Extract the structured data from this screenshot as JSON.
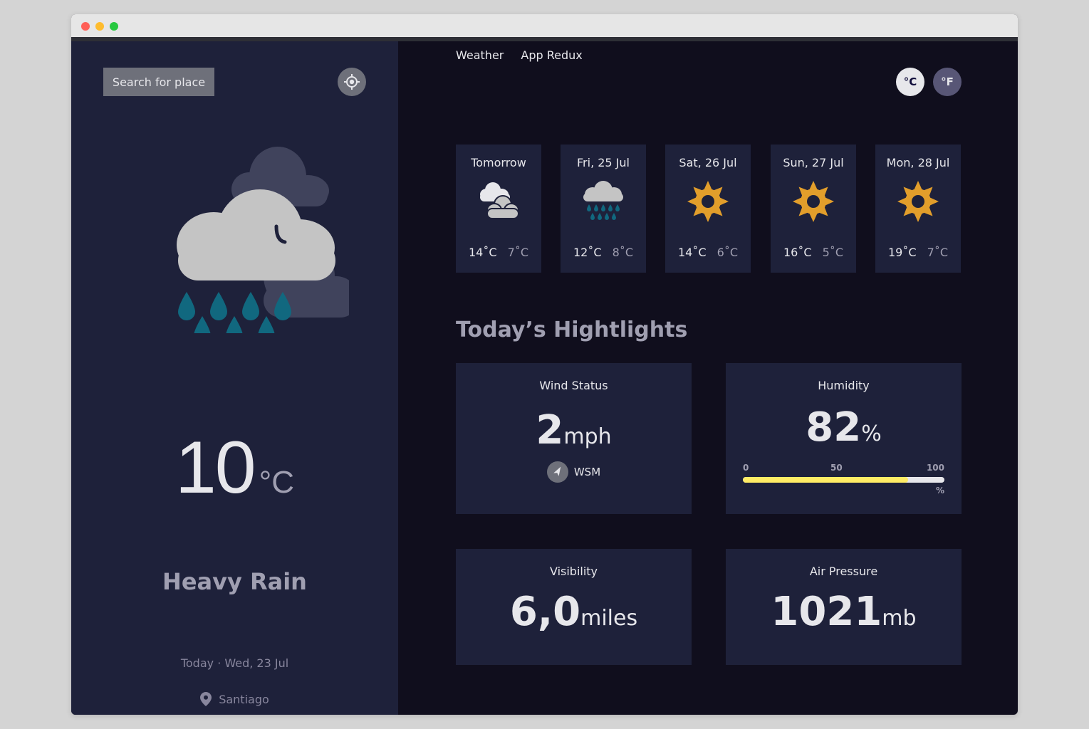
{
  "sidebar": {
    "search_label": "Search for place",
    "temperature": "10",
    "temperature_unit": "°C",
    "condition": "Heavy Rain",
    "date": "Today · Wed, 23 Jul",
    "location": "Santiago"
  },
  "header": {
    "brand_left": "Weather",
    "brand_right": "App Redux",
    "unit_c": "°C",
    "unit_f": "°F"
  },
  "forecast": [
    {
      "day": "Tomorrow",
      "max": "14˚C",
      "min": "7˚C",
      "icon": "sleet-cloud-icon"
    },
    {
      "day": "Fri, 25 Jul",
      "max": "12˚C",
      "min": "8˚C",
      "icon": "heavy-rain-icon"
    },
    {
      "day": "Sat, 26 Jul",
      "max": "14˚C",
      "min": "6˚C",
      "icon": "sun-icon"
    },
    {
      "day": "Sun, 27 Jul",
      "max": "16˚C",
      "min": "5˚C",
      "icon": "sun-icon"
    },
    {
      "day": "Mon, 28 Jul",
      "max": "19˚C",
      "min": "7˚C",
      "icon": "sun-icon"
    }
  ],
  "highlights": {
    "title": "Today’s Hightlights",
    "wind": {
      "label": "Wind Status",
      "value": "2",
      "unit": "mph",
      "direction": "WSM"
    },
    "humidity": {
      "label": "Humidity",
      "value": "82",
      "unit": "%",
      "percent": 82,
      "scale_0": "0",
      "scale_50": "50",
      "scale_100": "100",
      "scale_unit": "%"
    },
    "visibility": {
      "label": "Visibility",
      "value": "6,0",
      "unit": "miles"
    },
    "pressure": {
      "label": "Air Pressure",
      "value": "1021",
      "unit": "mb"
    }
  },
  "colors": {
    "sidebar_bg": "#1e213a",
    "main_bg": "#100e1d",
    "sun": "#e29e2b",
    "rain": "#11687f",
    "humidity_fill": "#ffec65"
  }
}
